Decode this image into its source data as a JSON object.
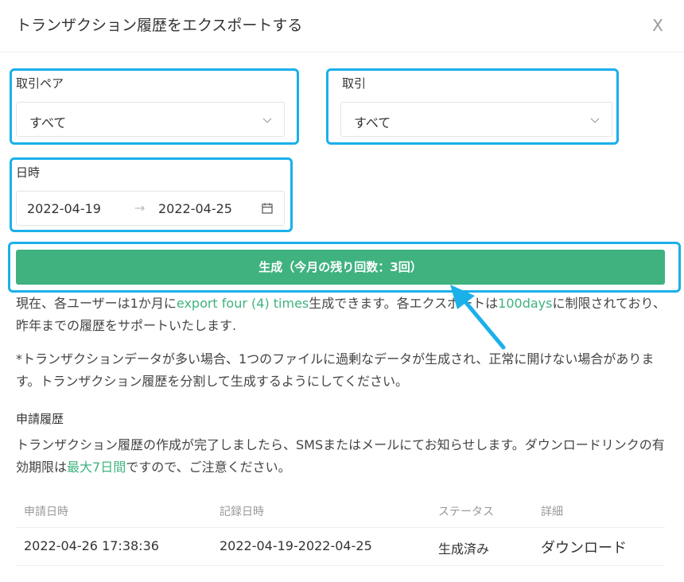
{
  "dialog": {
    "title": "トランザクション履歴をエクスポートする",
    "close": "X"
  },
  "filters": {
    "pair_label": "取引ペア",
    "pair_value": "すべて",
    "trade_label": "取引",
    "trade_value": "すべて",
    "date_label": "日時",
    "date_start": "2022-04-19",
    "date_arrow": "→",
    "date_end": "2022-04-25"
  },
  "generate_button": "生成（今月の残り回数：3回）",
  "info": {
    "p1_a": "現在、各ユーザーは1か月に",
    "p1_b": "export four (4) times",
    "p1_c": "生成できます。各エクスポートは",
    "p1_d": "100days",
    "p1_e": "に制限されており、昨年までの履歴をサポートいたします.",
    "p2": "*トランザクションデータが多い場合、1つのファイルに過剰なデータが生成され、正常に開けない場合があります。トランザクション履歴を分割して生成するようにしてください。"
  },
  "history": {
    "title": "申請履歴",
    "note_a": "トランザクション履歴の作成が完了しましたら、SMSまたはメールにてお知らせします。ダウンロードリンクの有効期限は",
    "note_b": "最大7日間",
    "note_c": "ですので、ご注意ください。",
    "columns": [
      "申請日時",
      "記録日時",
      "ステータス",
      "詳細"
    ],
    "rows": [
      {
        "applied": "2022-04-26 17:38:36",
        "recorded": "2022-04-19-2022-04-25",
        "status": "生成済み",
        "detail": "ダウンロード"
      }
    ]
  },
  "colors": {
    "accent_green": "#3fb27f",
    "highlight_blue": "#1ab0ea"
  },
  "icons": {
    "close": "close-icon",
    "select": "chevron-down-icon",
    "date": "calendar-icon"
  }
}
